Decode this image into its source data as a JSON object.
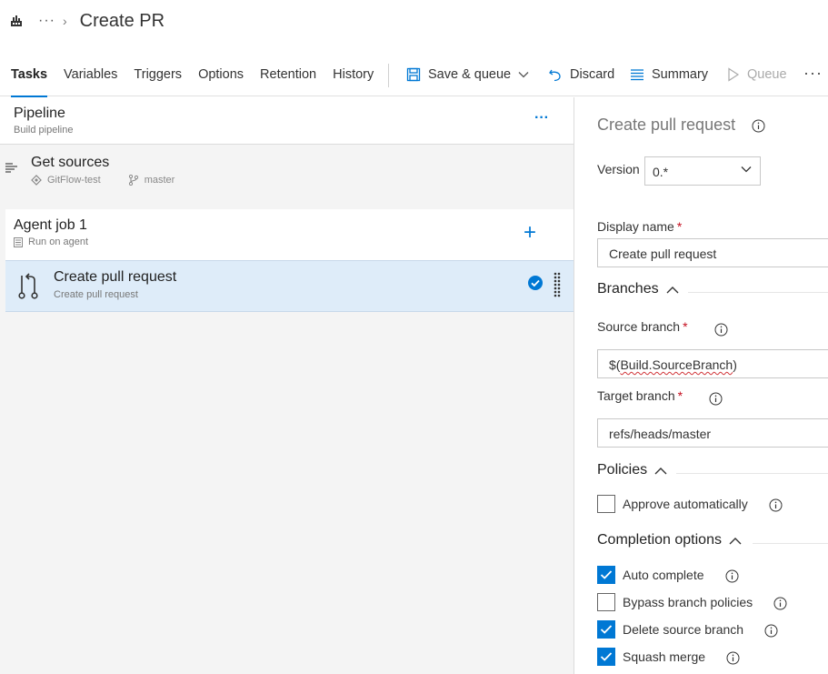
{
  "header": {
    "breadcrumb_more": "···",
    "breadcrumb_chevron": "›",
    "title": "Create PR"
  },
  "tabs": [
    {
      "label": "Tasks",
      "active": true
    },
    {
      "label": "Variables"
    },
    {
      "label": "Triggers"
    },
    {
      "label": "Options"
    },
    {
      "label": "Retention"
    },
    {
      "label": "History"
    }
  ],
  "toolbar": {
    "save_label": "Save & queue",
    "discard_label": "Discard",
    "summary_label": "Summary",
    "queue_label": "Queue",
    "more_label": "···"
  },
  "pipeline": {
    "title": "Pipeline",
    "subtitle": "Build pipeline",
    "more": "···"
  },
  "sources": {
    "title": "Get sources",
    "repo": "GitFlow-test",
    "branch": "master"
  },
  "agent_job": {
    "title": "Agent job 1",
    "subtitle": "Run on agent",
    "add": "+"
  },
  "task": {
    "title": "Create pull request",
    "subtitle": "Create pull request"
  },
  "details": {
    "title": "Create pull request",
    "version_label": "Version",
    "version_value": "0.*",
    "display_name_label": "Display name",
    "display_name_value": "Create pull request",
    "branches_section": "Branches",
    "source_branch_label": "Source branch",
    "source_branch_prefix": "$(",
    "source_branch_var": "Build.SourceBranch",
    "source_branch_suffix": ")",
    "target_branch_label": "Target branch",
    "target_branch_value": "refs/heads/master",
    "policies_section": "Policies",
    "approve_label": "Approve automatically",
    "completion_section": "Completion options",
    "auto_complete_label": "Auto complete",
    "bypass_label": "Bypass branch policies",
    "delete_source_label": "Delete source branch",
    "squash_label": "Squash merge",
    "required_mark": "*"
  },
  "checkboxes": {
    "approve": false,
    "auto_complete": true,
    "bypass": false,
    "delete_source": true,
    "squash": true
  },
  "colors": {
    "accent": "#0078d4",
    "selected_row": "#deecf9",
    "required": "#c50f1f"
  }
}
